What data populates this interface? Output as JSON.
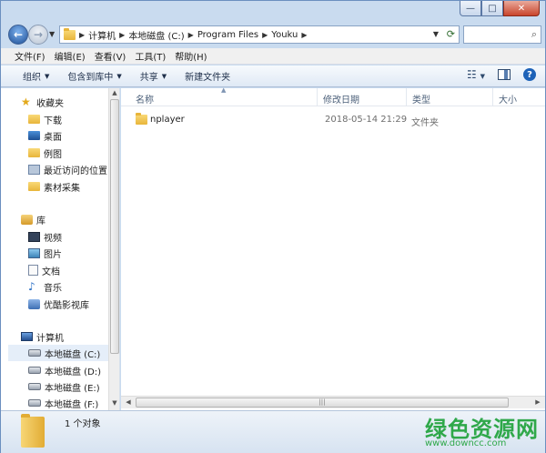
{
  "window": {
    "caption": {
      "minimize": "—",
      "maximize": "□",
      "close": "✕"
    }
  },
  "address": {
    "breadcrumbs": [
      "计算机",
      "本地磁盘 (C:)",
      "Program Files",
      "Youku"
    ]
  },
  "menubar": {
    "items": [
      "文件(F)",
      "编辑(E)",
      "查看(V)",
      "工具(T)",
      "帮助(H)"
    ]
  },
  "toolbar": {
    "organize": "组织",
    "include_library": "包含到库中",
    "share": "共享",
    "new_folder": "新建文件夹"
  },
  "navpane": {
    "favorites_header": "收藏夹",
    "favorites": [
      "下载",
      "桌面",
      "例图",
      "最近访问的位置",
      "素材采集"
    ],
    "libraries_header": "库",
    "libraries": [
      "视频",
      "图片",
      "文档",
      "音乐",
      "优酷影视库"
    ],
    "computer_header": "计算机",
    "drives": [
      "本地磁盘 (C:)",
      "本地磁盘 (D:)",
      "本地磁盘 (E:)",
      "本地磁盘 (F:)"
    ]
  },
  "columns": {
    "name": "名称",
    "date": "修改日期",
    "type": "类型",
    "size": "大小"
  },
  "files": [
    {
      "name": "nplayer",
      "date": "2018-05-14 21:29",
      "type": "文件夹"
    }
  ],
  "status": {
    "count": "1 个对象"
  },
  "watermark": {
    "text": "绿色资源网",
    "url": "www.downcc.com"
  }
}
